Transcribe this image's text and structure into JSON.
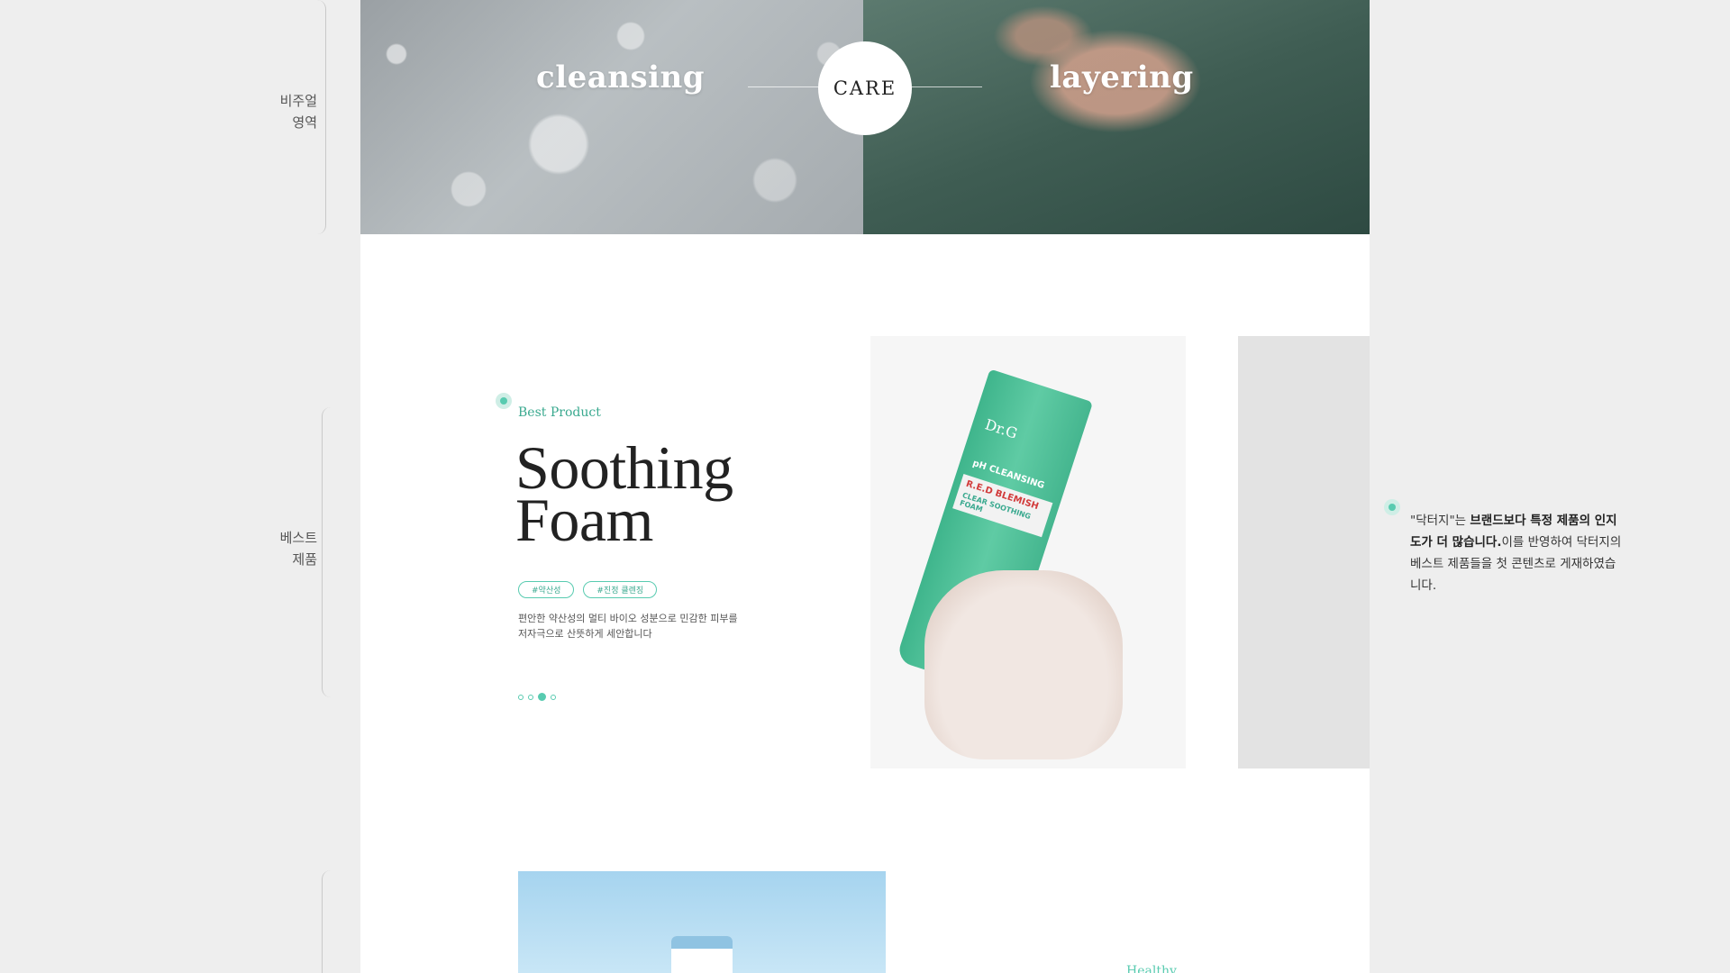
{
  "annotations": {
    "visual_area": [
      "비주얼",
      "영역"
    ],
    "best_product": [
      "베스트",
      "제품"
    ]
  },
  "hero": {
    "left_word": "cleansing",
    "center_word": "CARE",
    "right_word": "layering"
  },
  "best": {
    "eyebrow": "Best Product",
    "title_line1": "Soothing",
    "title_line2": "Foam",
    "tags": [
      "#약산성",
      "#진정 클렌징"
    ],
    "desc_line1": "편안한 약산성의 멀티 바이오 성분으로 민감한 피부를",
    "desc_line2": "저자극으로 산뜻하게 세안합니다",
    "pager_count": 4,
    "pager_active": 3
  },
  "product": {
    "brand": "Dr.G",
    "line1": "pH CLEANSING",
    "line2": "R.E.D BLEMISH",
    "line3": "CLEAR SOOTHING FOAM"
  },
  "peek": {
    "word": "Healthy"
  },
  "note": {
    "part1": "\"닥터지\"는 ",
    "bold": "브랜드보다 특정 제품의 인지도가 더 많습니다.",
    "part2": "이를 반영하여 닥터지의 베스트 제품들을 첫 콘텐츠로 게재하였습니다."
  },
  "colors": {
    "accent": "#58cbb0",
    "accent_text": "#3aa98f",
    "page_bg": "#eeeeee",
    "canvas_bg": "#ffffff"
  }
}
